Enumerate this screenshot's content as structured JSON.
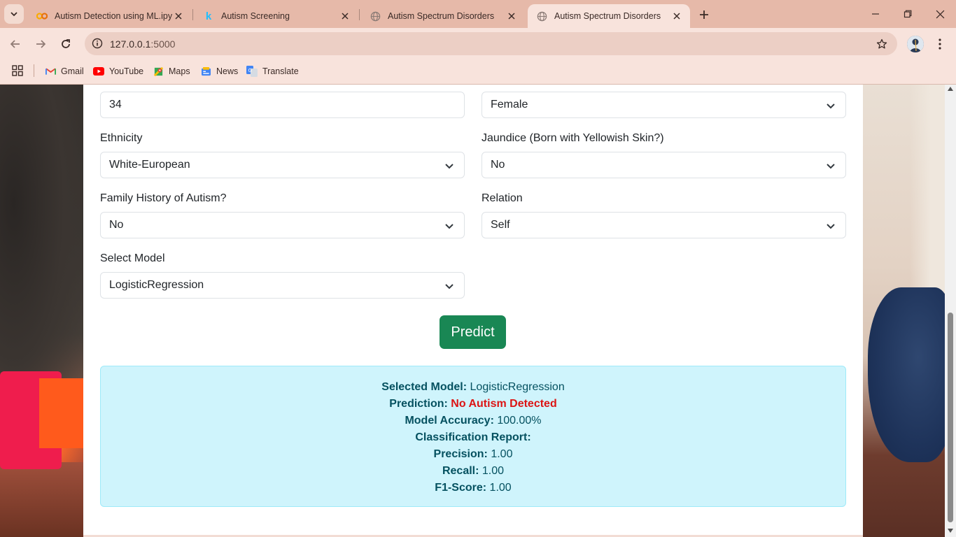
{
  "browser": {
    "tabs": [
      {
        "title": "Autism Detection using ML.ipyn",
        "icon": "colab-icon",
        "active": false
      },
      {
        "title": "Autism Screening",
        "icon": "kaggle-icon",
        "active": false
      },
      {
        "title": "Autism Spectrum Disorders",
        "icon": "globe-icon",
        "active": false
      },
      {
        "title": "Autism Spectrum Disorders",
        "icon": "globe-icon",
        "active": true
      }
    ],
    "url_host": "127.0.0.1",
    "url_port": ":5000",
    "bookmarks": [
      {
        "label": "Gmail",
        "icon": "gmail-icon"
      },
      {
        "label": "YouTube",
        "icon": "youtube-icon"
      },
      {
        "label": "Maps",
        "icon": "maps-icon"
      },
      {
        "label": "News",
        "icon": "news-icon"
      },
      {
        "label": "Translate",
        "icon": "translate-icon"
      }
    ]
  },
  "form": {
    "age_value": "34",
    "gender_value": "Female",
    "ethnicity": {
      "label": "Ethnicity",
      "value": "White-European"
    },
    "jaundice": {
      "label": "Jaundice (Born with Yellowish Skin?)",
      "value": "No"
    },
    "family_history": {
      "label": "Family History of Autism?",
      "value": "No"
    },
    "relation": {
      "label": "Relation",
      "value": "Self"
    },
    "model": {
      "label": "Select Model",
      "value": "LogisticRegression"
    },
    "predict_label": "Predict"
  },
  "result": {
    "selected_model_label": "Selected Model:",
    "selected_model_value": "LogisticRegression",
    "prediction_label": "Prediction:",
    "prediction_value": "No Autism Detected",
    "accuracy_label": "Model Accuracy:",
    "accuracy_value": "100.00%",
    "report_label": "Classification Report:",
    "precision_label": "Precision:",
    "precision_value": "1.00",
    "recall_label": "Recall:",
    "recall_value": "1.00",
    "f1_label": "F1-Score:",
    "f1_value": "1.00"
  },
  "colors": {
    "predict_button": "#198754",
    "alert_bg": "#cff4fc",
    "prediction_text": "#dc1414"
  }
}
